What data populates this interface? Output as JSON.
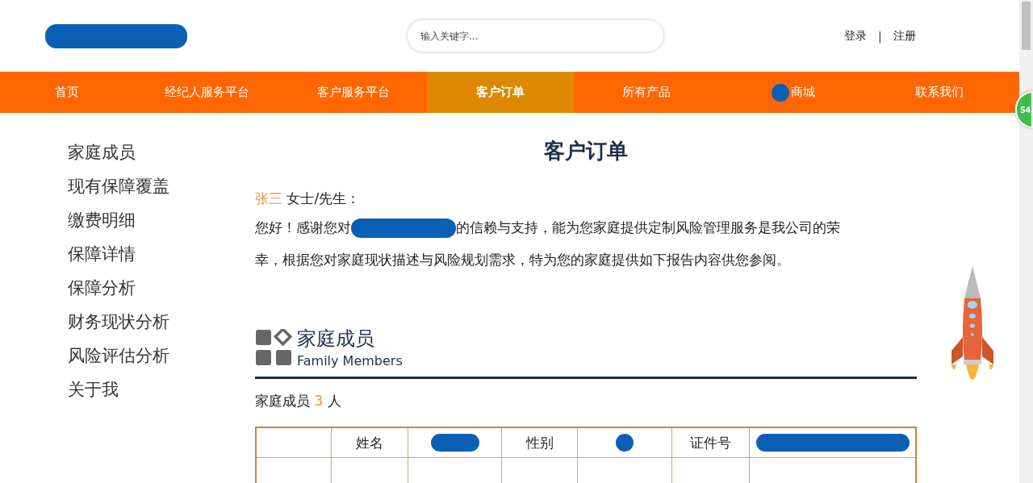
{
  "header": {
    "search": {
      "placeholder": "输入关键字..."
    },
    "auth_links": [
      {
        "label": "登录"
      },
      {
        "label": "注册"
      }
    ],
    "separator": "|"
  },
  "nav": [
    {
      "label": "首页",
      "selected": false
    },
    {
      "label": "经纪人服务平台",
      "selected": false
    },
    {
      "label": "客户服务平台",
      "selected": false
    },
    {
      "label": "客户订单",
      "selected": true
    },
    {
      "label": "所有产品",
      "selected": false
    },
    {
      "label": "商城",
      "selected": false,
      "redacted_prefix": true
    },
    {
      "label": "联系我们",
      "selected": false
    }
  ],
  "sidebar": {
    "items": [
      "家庭成员",
      "现有保障覆盖",
      "缴费明细",
      "保障详情",
      "保障分析",
      "财务现状分析",
      "风险评估分析",
      "关于我"
    ]
  },
  "page_title": "客户订单",
  "salutation": {
    "name": "张三",
    "rest": "女士/先生："
  },
  "greeting": {
    "before": "您好！感谢您对",
    "middle": "的信赖与支持，能为您家庭提供定制风险管理服务是我公司的荣",
    "after": "幸，根据您对家庭现状描述与风险规划需求，特为您的家庭提供如下报告内容供您参阅。"
  },
  "section": {
    "title": "家庭成员",
    "subtitle": "Family Members"
  },
  "member_count": {
    "label": "家庭成员",
    "count": "3",
    "unit": "人"
  },
  "table": {
    "rows": [
      [
        {
          "kind": "empty"
        },
        {
          "kind": "text",
          "text": "姓名"
        },
        {
          "kind": "redacted"
        },
        {
          "kind": "text",
          "text": "性别"
        },
        {
          "kind": "redacted"
        },
        {
          "kind": "text",
          "text": "证件号"
        },
        {
          "kind": "redacted"
        }
      ]
    ]
  },
  "side_badge": "54"
}
